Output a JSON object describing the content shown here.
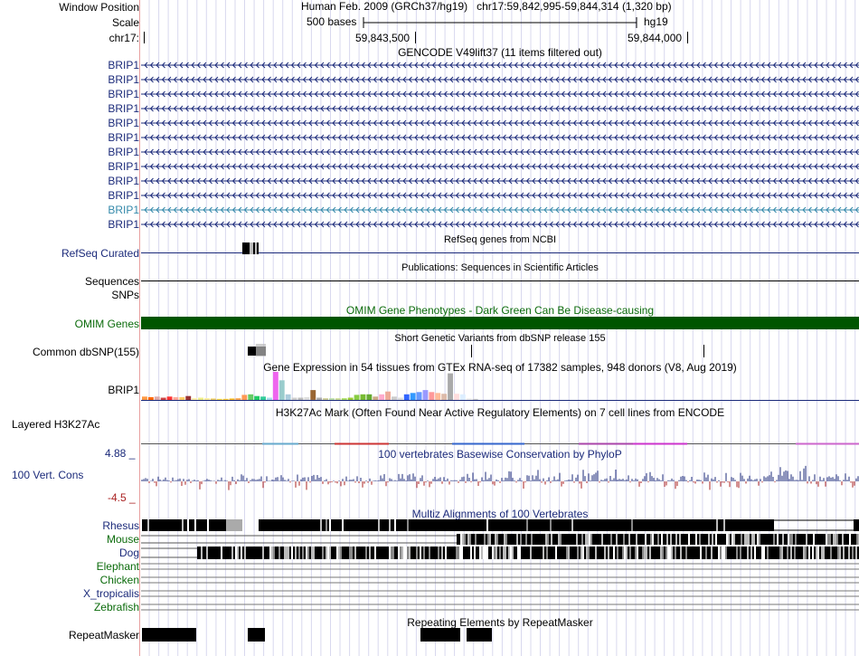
{
  "header": {
    "window_position_label": "Window Position",
    "assembly_info": "Human Feb. 2009 (GRCh37/hg19)",
    "position": "chr17:59,842,995-59,844,314",
    "span": "(1,320 bp)",
    "scale_label": "Scale",
    "scale_text": "500 bases",
    "db": "hg19",
    "chrom_label": "chr17:",
    "tick1": "59,843,500",
    "tick2": "59,844,000"
  },
  "gencode": {
    "title": "GENCODE V49lift37 (11 items filtered out)",
    "rows": [
      "BRIP1",
      "BRIP1",
      "BRIP1",
      "BRIP1",
      "BRIP1",
      "BRIP1",
      "BRIP1",
      "BRIP1",
      "BRIP1",
      "BRIP1",
      "BRIP1",
      "BRIP1"
    ],
    "highlight_row": 10,
    "colors": {
      "default": "#1b2a7a",
      "highlight": "#3388aa"
    }
  },
  "refseq": {
    "label": "RefSeq Curated",
    "title": "RefSeq genes from NCBI"
  },
  "publications": {
    "label": "Sequences",
    "title": "Publications: Sequences in Scientific Articles"
  },
  "snps": {
    "label": "SNPs"
  },
  "omim": {
    "label": "OMIM Genes",
    "title": "OMIM Gene Phenotypes - Dark Green Can Be Disease-causing",
    "color": "#005500"
  },
  "dbsnp": {
    "label": "Common dbSNP(155)",
    "title": "Short Genetic Variants from dbSNP release 155"
  },
  "gtex": {
    "label": "BRIP1",
    "title": "Gene Expression in 54 tissues from GTEx RNA-seq of 17382 samples, 948 donors (V8, Aug 2019)",
    "values": [
      0.12,
      0.1,
      0.12,
      0.08,
      0.12,
      0.1,
      0.1,
      0.14,
      0.06,
      0.08,
      0.06,
      0.05,
      0.04,
      0.04,
      0.05,
      0.06,
      0.18,
      0.2,
      0.14,
      0.12,
      0.08,
      1.0,
      0.7,
      0.2,
      0.08,
      0.08,
      0.1,
      0.35,
      0.08,
      0.06,
      0.06,
      0.06,
      0.06,
      0.08,
      0.18,
      0.2,
      0.2,
      0.12,
      0.2,
      0.3,
      0.12,
      0.08,
      0.2,
      0.25,
      0.28,
      0.35,
      0.28,
      0.25,
      0.22,
      0.95,
      0.22,
      0.2,
      0.06,
      0.04
    ],
    "colors": [
      "#ff9944",
      "#ff6600",
      "#ddaaaa",
      "#cc4444",
      "#ff3333",
      "#ffaa99",
      "#ffcc66",
      "#993333",
      "#ffeeaa",
      "#eeee88",
      "#ffee99",
      "#eecc66",
      "#ffdd44",
      "#ffcc33",
      "#ffbb22",
      "#ffaa55",
      "#ff9955",
      "#66cc66",
      "#22cc66",
      "#33cc99",
      "#aaddee",
      "#ee66ee",
      "#99cccc",
      "#aaccdd",
      "#cccccc",
      "#bbbbbb",
      "#dddddd",
      "#996633",
      "#aaaaaa",
      "#cccc99",
      "#bbddaa",
      "#ccdd99",
      "#aadd66",
      "#99cc33",
      "#88cc44",
      "#77bb33",
      "#66aa33",
      "#ccaa88",
      "#ffaacc",
      "#eeaa99",
      "#cccccc",
      "#dddddd",
      "#3366ff",
      "#3399ff",
      "#6699ff",
      "#9999ff",
      "#ff9999",
      "#ffbb99",
      "#ddbbaa",
      "#aaaaaa",
      "#ffdddd",
      "#ddeeff",
      "#eeeeee",
      "#cccccc"
    ]
  },
  "h3k27ac": {
    "label": "Layered H3K27Ac",
    "title": "H3K27Ac Mark (Often Found Near Active Regulatory Elements) on 7 cell lines from ENCODE"
  },
  "cons": {
    "label": "100 Vert. Cons",
    "max": "4.88 _",
    "min": "-4.5 _",
    "title": "100 vertebrates Basewise Conservation by PhyloP",
    "pos_color": "#1b2a7a",
    "neg_color": "#aa2222"
  },
  "multiz": {
    "title": "Multiz Alignments of 100 Vertebrates",
    "species": [
      {
        "name": "Rhesus",
        "color": "navy"
      },
      {
        "name": "Mouse",
        "color": "green"
      },
      {
        "name": "Dog",
        "color": "navy"
      },
      {
        "name": "Elephant",
        "color": "green"
      },
      {
        "name": "Chicken",
        "color": "green"
      },
      {
        "name": "X_tropicalis",
        "color": "navy"
      },
      {
        "name": "Zebrafish",
        "color": "green"
      }
    ]
  },
  "repeatmasker": {
    "label": "RepeatMasker",
    "title": "Repeating Elements by RepeatMasker"
  }
}
